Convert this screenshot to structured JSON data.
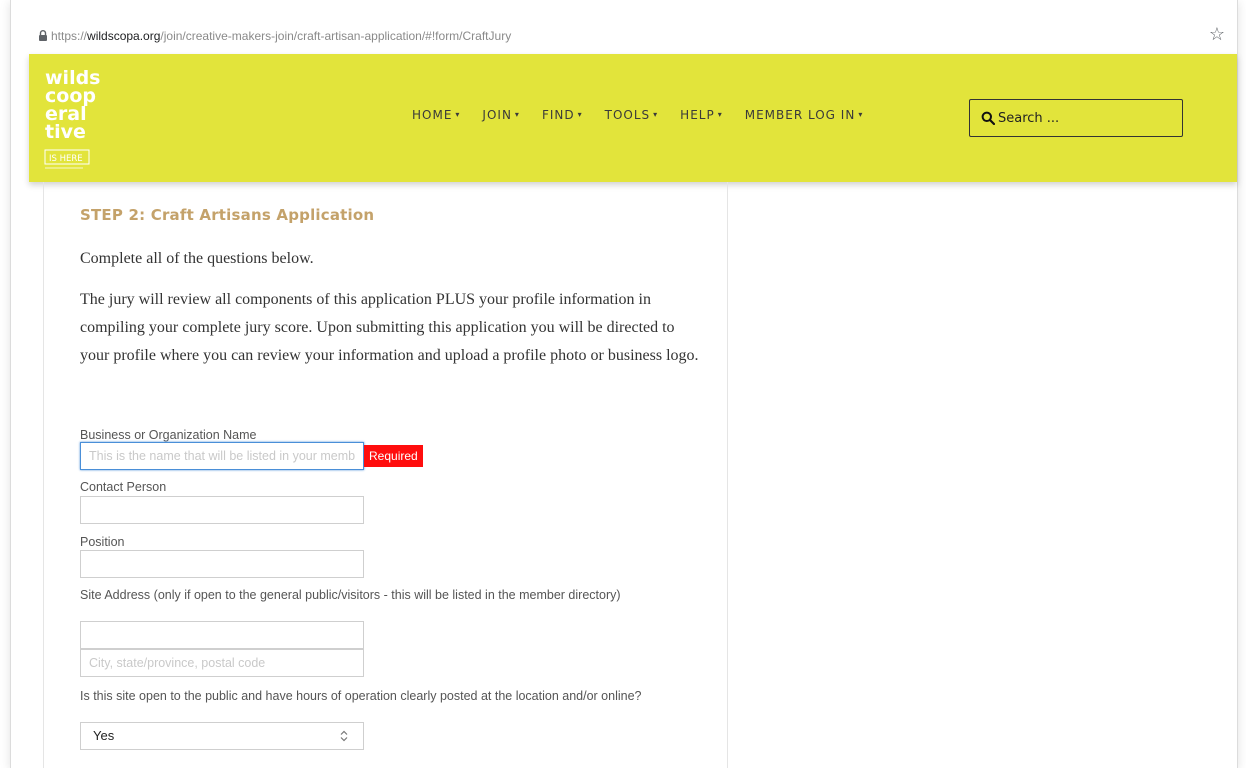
{
  "browser": {
    "url_prefix": "https://",
    "url_domain": "wildscopa.org",
    "url_path": "/join/creative-makers-join/craft-artisan-application/#!form/CraftJury",
    "lock_icon": "lock-icon",
    "star_icon": "bookmark-star-icon"
  },
  "header": {
    "bg_color": "#e2e43b",
    "logo_lines": [
      "wilds",
      "coop",
      "eral",
      "tive",
      "IS HERE"
    ],
    "nav": [
      {
        "label": "HOME"
      },
      {
        "label": "JOIN"
      },
      {
        "label": "FIND"
      },
      {
        "label": "TOOLS"
      },
      {
        "label": "HELP"
      },
      {
        "label": "MEMBER LOG IN"
      }
    ],
    "search_placeholder": "Search ..."
  },
  "form": {
    "title": "STEP 2: Craft Artisans Application",
    "title_color": "#c4a26a",
    "intro": "Complete all of the questions below.",
    "paragraph": "The jury will review all components of this application PLUS your profile information in compiling your complete jury score. Upon submitting this application you will be directed to your profile where you can review your information and upload a profile photo or business logo.",
    "business_label": "Business or Organization Name",
    "business_placeholder": "This is the name that will be listed in your member directory",
    "required_label": "Required",
    "required_color": "#ff0d0d",
    "contact_label": "Contact Person",
    "position_label": "Position",
    "site_address_label": "Site Address (only if open to the general public/visitors - this will be listed in the member directory)",
    "city_placeholder": "City, state/province, postal code",
    "open_question": "Is this site open to the public and have hours of operation clearly posted at the location and/or online?",
    "open_value": "Yes"
  }
}
